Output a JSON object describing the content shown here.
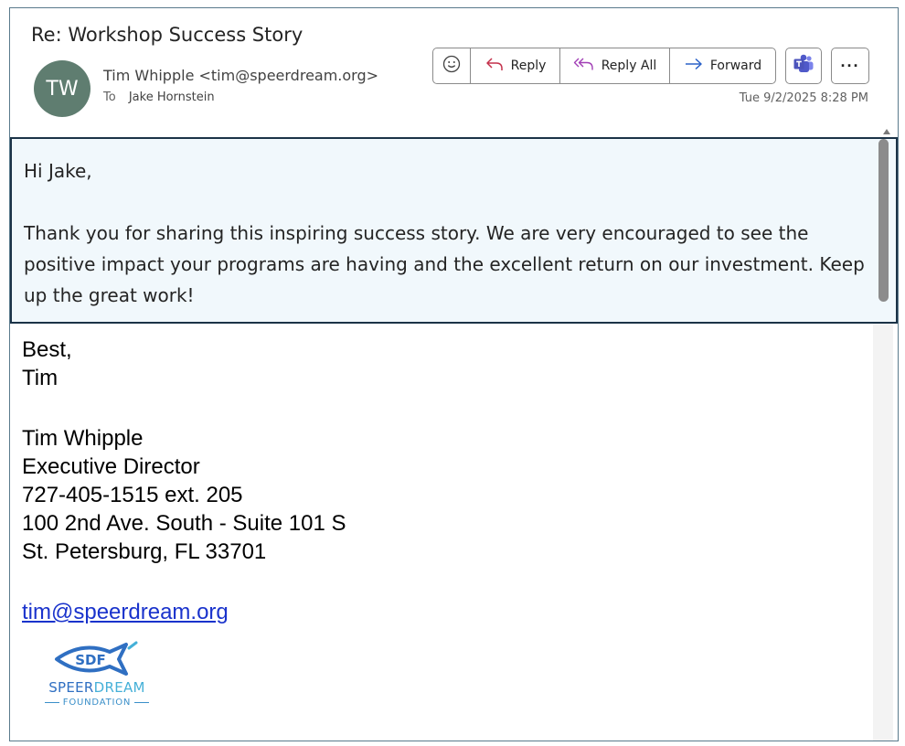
{
  "header": {
    "subject": "Re: Workshop Success Story",
    "avatar_initials": "TW",
    "sender": "Tim Whipple <tim@speerdream.org>",
    "to_label": "To",
    "to_name": "Jake Hornstein",
    "date": "Tue 9/2/2025 8:28 PM"
  },
  "actions": {
    "emoji_icon": "smiley-icon",
    "reply_label": "Reply",
    "reply_all_label": "Reply All",
    "forward_label": "Forward",
    "teams_icon": "teams-icon",
    "more_label": "···"
  },
  "body": {
    "greeting": "Hi Jake,",
    "paragraph": "Thank you for sharing this inspiring success story. We are very encouraged to see the positive impact your programs are having and the excellent return on our investment. Keep up the great work!"
  },
  "signature": {
    "closing": "Best,",
    "first_name": "Tim",
    "full_name": "Tim Whipple",
    "title": "Executive Director",
    "phone": "727-405-1515 ext. 205",
    "address_line1": "100 2nd Ave. South - Suite 101 S",
    "address_line2": "St. Petersburg, FL 33701",
    "email": "tim@speerdream.org"
  },
  "logo": {
    "mark": "SDF",
    "name_part1": "SPEER",
    "name_part2": "DREAM",
    "subtitle": "FOUNDATION"
  },
  "colors": {
    "avatar_bg": "#5f7d70",
    "highlight_bg": "#f1f8fc",
    "highlight_border": "#1b3347",
    "link": "#1a33cc",
    "logo_blue": "#2f6fc2",
    "logo_light_blue": "#45b0d8"
  }
}
